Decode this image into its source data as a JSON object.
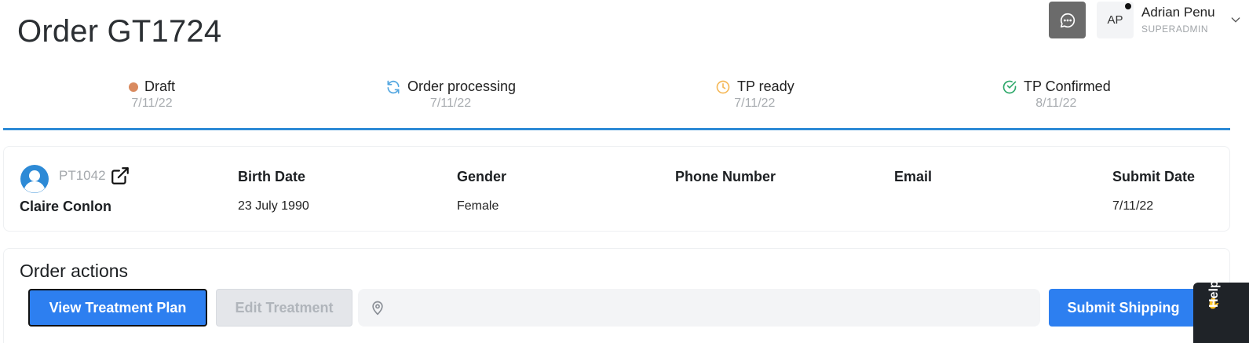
{
  "page": {
    "title": "Order GT1724"
  },
  "header": {
    "user": {
      "initials": "AP",
      "name": "Adrian Penu",
      "role": "SUPERADMIN"
    }
  },
  "steps": [
    {
      "label": "Draft",
      "date": "7/11/22",
      "icon": "dot-icon",
      "color": "#d98a5f"
    },
    {
      "label": "Order processing",
      "date": "7/11/22",
      "icon": "refresh-icon",
      "color": "#52a6e0"
    },
    {
      "label": "TP ready",
      "date": "7/11/22",
      "icon": "clock-icon",
      "color": "#f5b95a"
    },
    {
      "label": "TP Confirmed",
      "date": "8/11/22",
      "icon": "check-circle-icon",
      "color": "#2ea86a"
    }
  ],
  "patient": {
    "id": "PT1042",
    "name": "Claire Conlon",
    "fields": [
      {
        "label": "Birth Date",
        "value": "23 July 1990"
      },
      {
        "label": "Gender",
        "value": "Female"
      },
      {
        "label": "Phone Number",
        "value": ""
      },
      {
        "label": "Email",
        "value": ""
      },
      {
        "label": "Submit Date",
        "value": "7/11/22"
      }
    ]
  },
  "actions": {
    "title": "Order actions",
    "view_treatment_plan": "View Treatment Plan",
    "edit_treatment": "Edit Treatment",
    "location_value": "",
    "submit_shipping": "Submit Shipping"
  },
  "help": {
    "label": "Help?"
  },
  "colors": {
    "accent": "#2d7ff0",
    "progress_line": "#2d8ad6"
  }
}
